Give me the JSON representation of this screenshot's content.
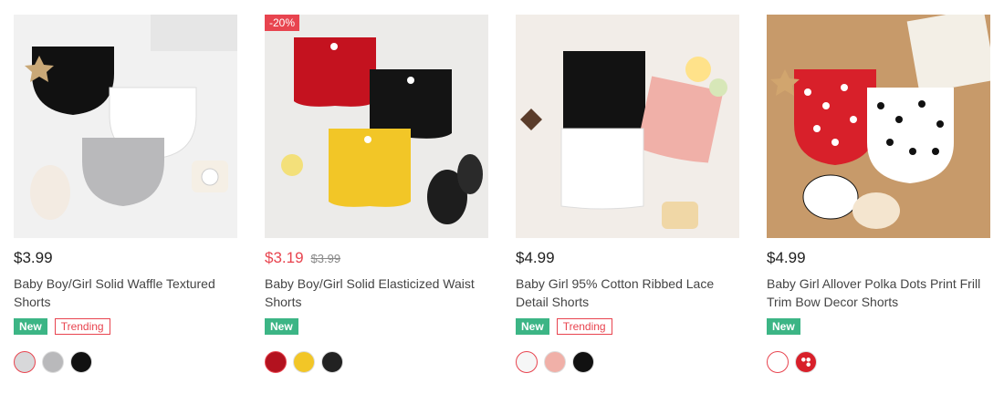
{
  "products": [
    {
      "price": "$3.99",
      "title": "Baby Boy/Girl Solid Waffle Textured Shorts",
      "tags": {
        "new": "New",
        "trending": "Trending"
      },
      "swatches": [
        "#d8d8da",
        "#b9b9bb",
        "#111111"
      ]
    },
    {
      "discount": "-20%",
      "price": "$3.19",
      "original_price": "$3.99",
      "title": "Baby Boy/Girl Solid Elasticized Waist Shorts",
      "tags": {
        "new": "New"
      },
      "swatches": [
        "#b3121f",
        "#f2c627",
        "#222222"
      ]
    },
    {
      "price": "$4.99",
      "title": "Baby Girl 95% Cotton Ribbed Lace Detail Shorts",
      "tags": {
        "new": "New",
        "trending": "Trending"
      },
      "swatches": [
        "#f6f6f6",
        "#f0b0a8",
        "#111111"
      ]
    },
    {
      "price": "$4.99",
      "title": "Baby Girl Allover Polka Dots Print Frill Trim Bow Decor Shorts",
      "tags": {
        "new": "New"
      },
      "swatches": [
        "#ffffff",
        "#d8202a"
      ]
    }
  ],
  "colors": {
    "sale": "#e8444f",
    "new_tag": "#3cb585"
  },
  "icons": [
    "product-photo",
    "color-swatch"
  ]
}
